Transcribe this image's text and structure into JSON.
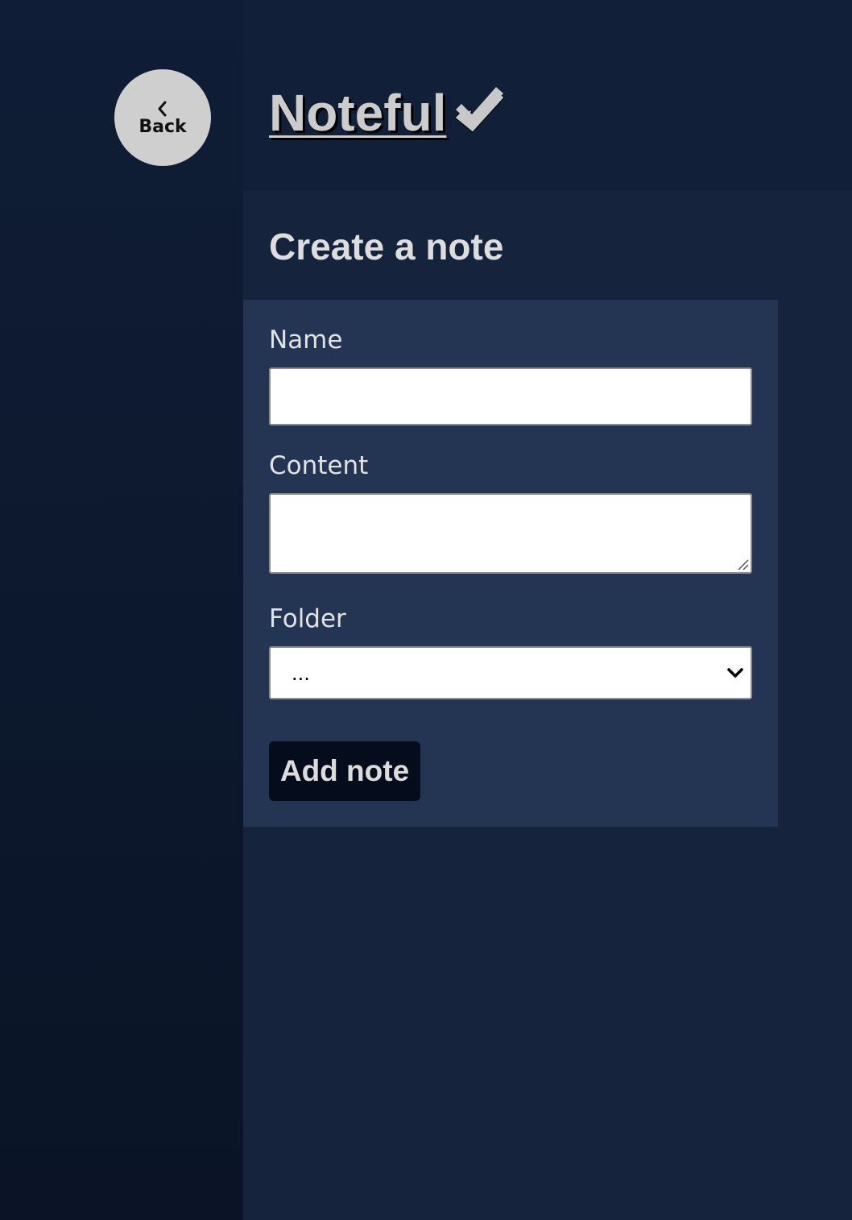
{
  "nav": {
    "back_label": "Back",
    "back_icon": "chevron-left-icon"
  },
  "header": {
    "app_title": "Noteful",
    "logo_icon": "double-check-icon"
  },
  "form": {
    "title": "Create a note",
    "name_label": "Name",
    "name_value": "",
    "content_label": "Content",
    "content_value": "",
    "folder_label": "Folder",
    "folder_selected": "...",
    "submit_label": "Add note"
  },
  "colors": {
    "sidebar_bg": "#0f1d36",
    "main_bg": "#15233d",
    "panel_bg": "#233553",
    "button_bg": "#050d1d",
    "back_button_bg": "#cfcfcf"
  }
}
